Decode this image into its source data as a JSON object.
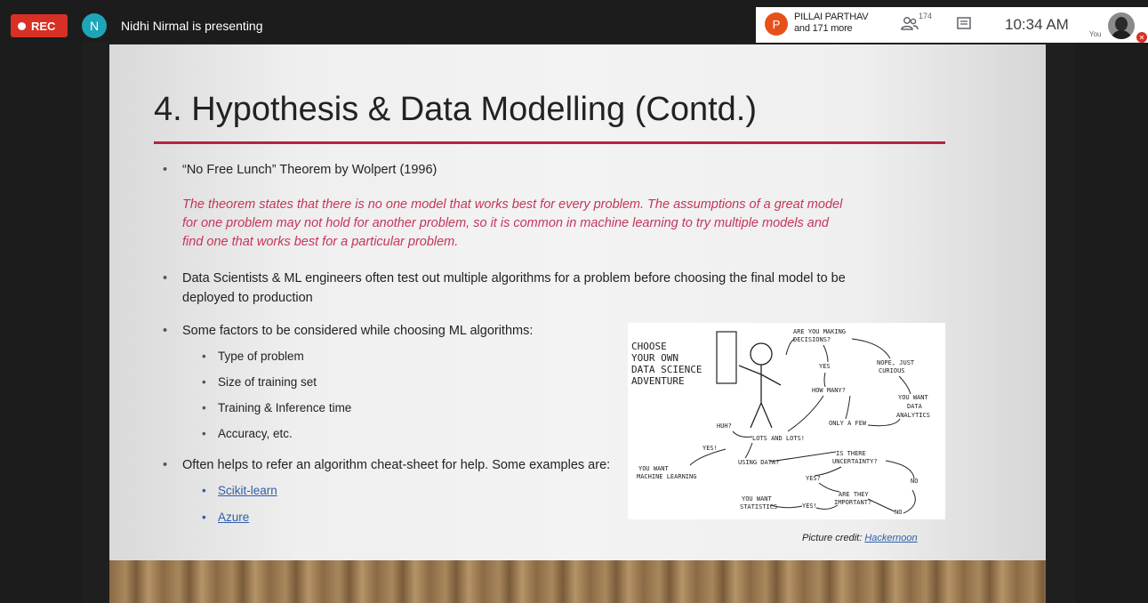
{
  "meeting": {
    "rec_label": "REC",
    "presenter_initial": "N",
    "presenting_text": "Nidhi Nirmal is presenting",
    "participant_initial": "P",
    "participant_name": "PILLAI PARTHAV",
    "participant_more": "and 171 more",
    "people_count": "174",
    "time": "10:34 AM",
    "self_label": "You"
  },
  "slide": {
    "title": "4. Hypothesis & Data Modelling (Contd.)",
    "bullet1": "“No Free Lunch” Theorem by Wolpert (1996)",
    "quote_line1": "The theorem states that there is no one model that works best for every problem.  The assumptions of a great model",
    "quote_line2": "for one problem may not hold for another problem, so it is common in machine learning to try multiple models and",
    "quote_line3": "find one that works best for a particular problem.",
    "bullet2_line1": "Data Scientists & ML engineers often test out multiple algorithms for a problem before choosing the final model to be",
    "bullet2_line2": "deployed to production",
    "bullet3": "Some factors to be considered while choosing ML algorithms:",
    "factors": [
      "Type of problem",
      "Size of training set",
      "Training & Inference time",
      "Accuracy, etc."
    ],
    "bullet4": "Often helps to refer an algorithm cheat-sheet for help. Some examples are:",
    "links": [
      "Scikit-learn",
      "Azure"
    ],
    "credit_prefix": "Picture credit: ",
    "credit_link": "Hackernoon"
  },
  "comic": {
    "title_lines": [
      "CHOOSE",
      "YOUR OWN",
      "DATA SCIENCE",
      "ADVENTURE"
    ],
    "labels": [
      "ARE YOU MAKING",
      "DECISIONS?",
      "YES",
      "NOPE, JUST",
      "CURIOUS",
      "HOW MANY?",
      "YOU WANT",
      "DATA",
      "ANALYTICS",
      "ONLY A FEW",
      "HUH?",
      "LOTS AND LOTS!",
      "YES!",
      "USING DATA?",
      "IS THERE",
      "UNCERTAINTY?",
      "YOU WANT",
      "MACHINE LEARNING",
      "YES?",
      "NO",
      "ARE THEY",
      "IMPORTANT?",
      "YOU WANT",
      "STATISTICS",
      "YES!",
      "NO"
    ]
  },
  "colors": {
    "accent_red": "#b8223d",
    "quote_pink": "#c4365b",
    "rec_red": "#d93025",
    "presenter_teal": "#1ea5b8",
    "participant_orange": "#e8501b",
    "link_blue": "#2f5ea8"
  }
}
